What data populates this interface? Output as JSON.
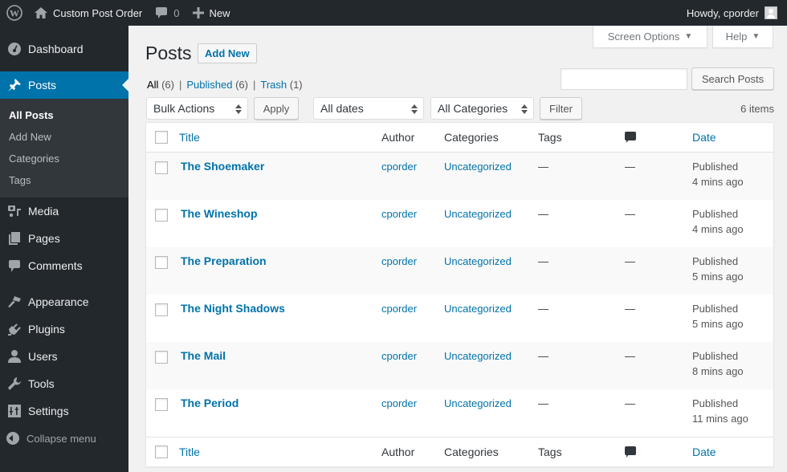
{
  "adminbar": {
    "site_name": "Custom Post Order",
    "comments_count": "0",
    "new_label": "New",
    "howdy": "Howdy, cporder"
  },
  "sidebar": {
    "items": [
      {
        "label": "Dashboard",
        "icon": "dashboard-icon"
      },
      {
        "label": "Posts",
        "icon": "pin-icon",
        "active": true
      },
      {
        "label": "Media",
        "icon": "media-icon"
      },
      {
        "label": "Pages",
        "icon": "pages-icon"
      },
      {
        "label": "Comments",
        "icon": "comment-icon"
      },
      {
        "label": "Appearance",
        "icon": "paintbrush-icon"
      },
      {
        "label": "Plugins",
        "icon": "plug-icon"
      },
      {
        "label": "Users",
        "icon": "user-icon"
      },
      {
        "label": "Tools",
        "icon": "wrench-icon"
      },
      {
        "label": "Settings",
        "icon": "settings-icon"
      }
    ],
    "submenu": [
      "All Posts",
      "Add New",
      "Categories",
      "Tags"
    ],
    "collapse_label": "Collapse menu"
  },
  "screen_meta": {
    "screen_options": "Screen Options",
    "help": "Help"
  },
  "page": {
    "title": "Posts",
    "add_new": "Add New",
    "views": [
      {
        "label": "All",
        "count": "(6)",
        "current": true
      },
      {
        "label": "Published",
        "count": "(6)"
      },
      {
        "label": "Trash",
        "count": "(1)"
      }
    ],
    "search_value": "",
    "search_button": "Search Posts",
    "bulk_actions": "Bulk Actions",
    "apply": "Apply",
    "dates_filter": "All dates",
    "categories_filter": "All Categories",
    "filter": "Filter",
    "items_count": "6 items"
  },
  "table": {
    "columns": {
      "title": "Title",
      "author": "Author",
      "categories": "Categories",
      "tags": "Tags",
      "date": "Date"
    },
    "rows": [
      {
        "title": "The Shoemaker",
        "author": "cporder",
        "category": "Uncategorized",
        "tags": "—",
        "comments": "—",
        "status": "Published",
        "time": "4 mins ago"
      },
      {
        "title": "The Wineshop",
        "author": "cporder",
        "category": "Uncategorized",
        "tags": "—",
        "comments": "—",
        "status": "Published",
        "time": "4 mins ago"
      },
      {
        "title": "The Preparation",
        "author": "cporder",
        "category": "Uncategorized",
        "tags": "—",
        "comments": "—",
        "status": "Published",
        "time": "5 mins ago"
      },
      {
        "title": "The Night Shadows",
        "author": "cporder",
        "category": "Uncategorized",
        "tags": "—",
        "comments": "—",
        "status": "Published",
        "time": "5 mins ago"
      },
      {
        "title": "The Mail",
        "author": "cporder",
        "category": "Uncategorized",
        "tags": "—",
        "comments": "—",
        "status": "Published",
        "time": "8 mins ago"
      },
      {
        "title": "The Period",
        "author": "cporder",
        "category": "Uncategorized",
        "tags": "—",
        "comments": "—",
        "status": "Published",
        "time": "11 mins ago"
      }
    ]
  },
  "colors": {
    "adminbar_bg": "#23282d",
    "accent": "#0073aa",
    "submenu_bg": "#32373c",
    "page_bg": "#f1f1f1"
  }
}
